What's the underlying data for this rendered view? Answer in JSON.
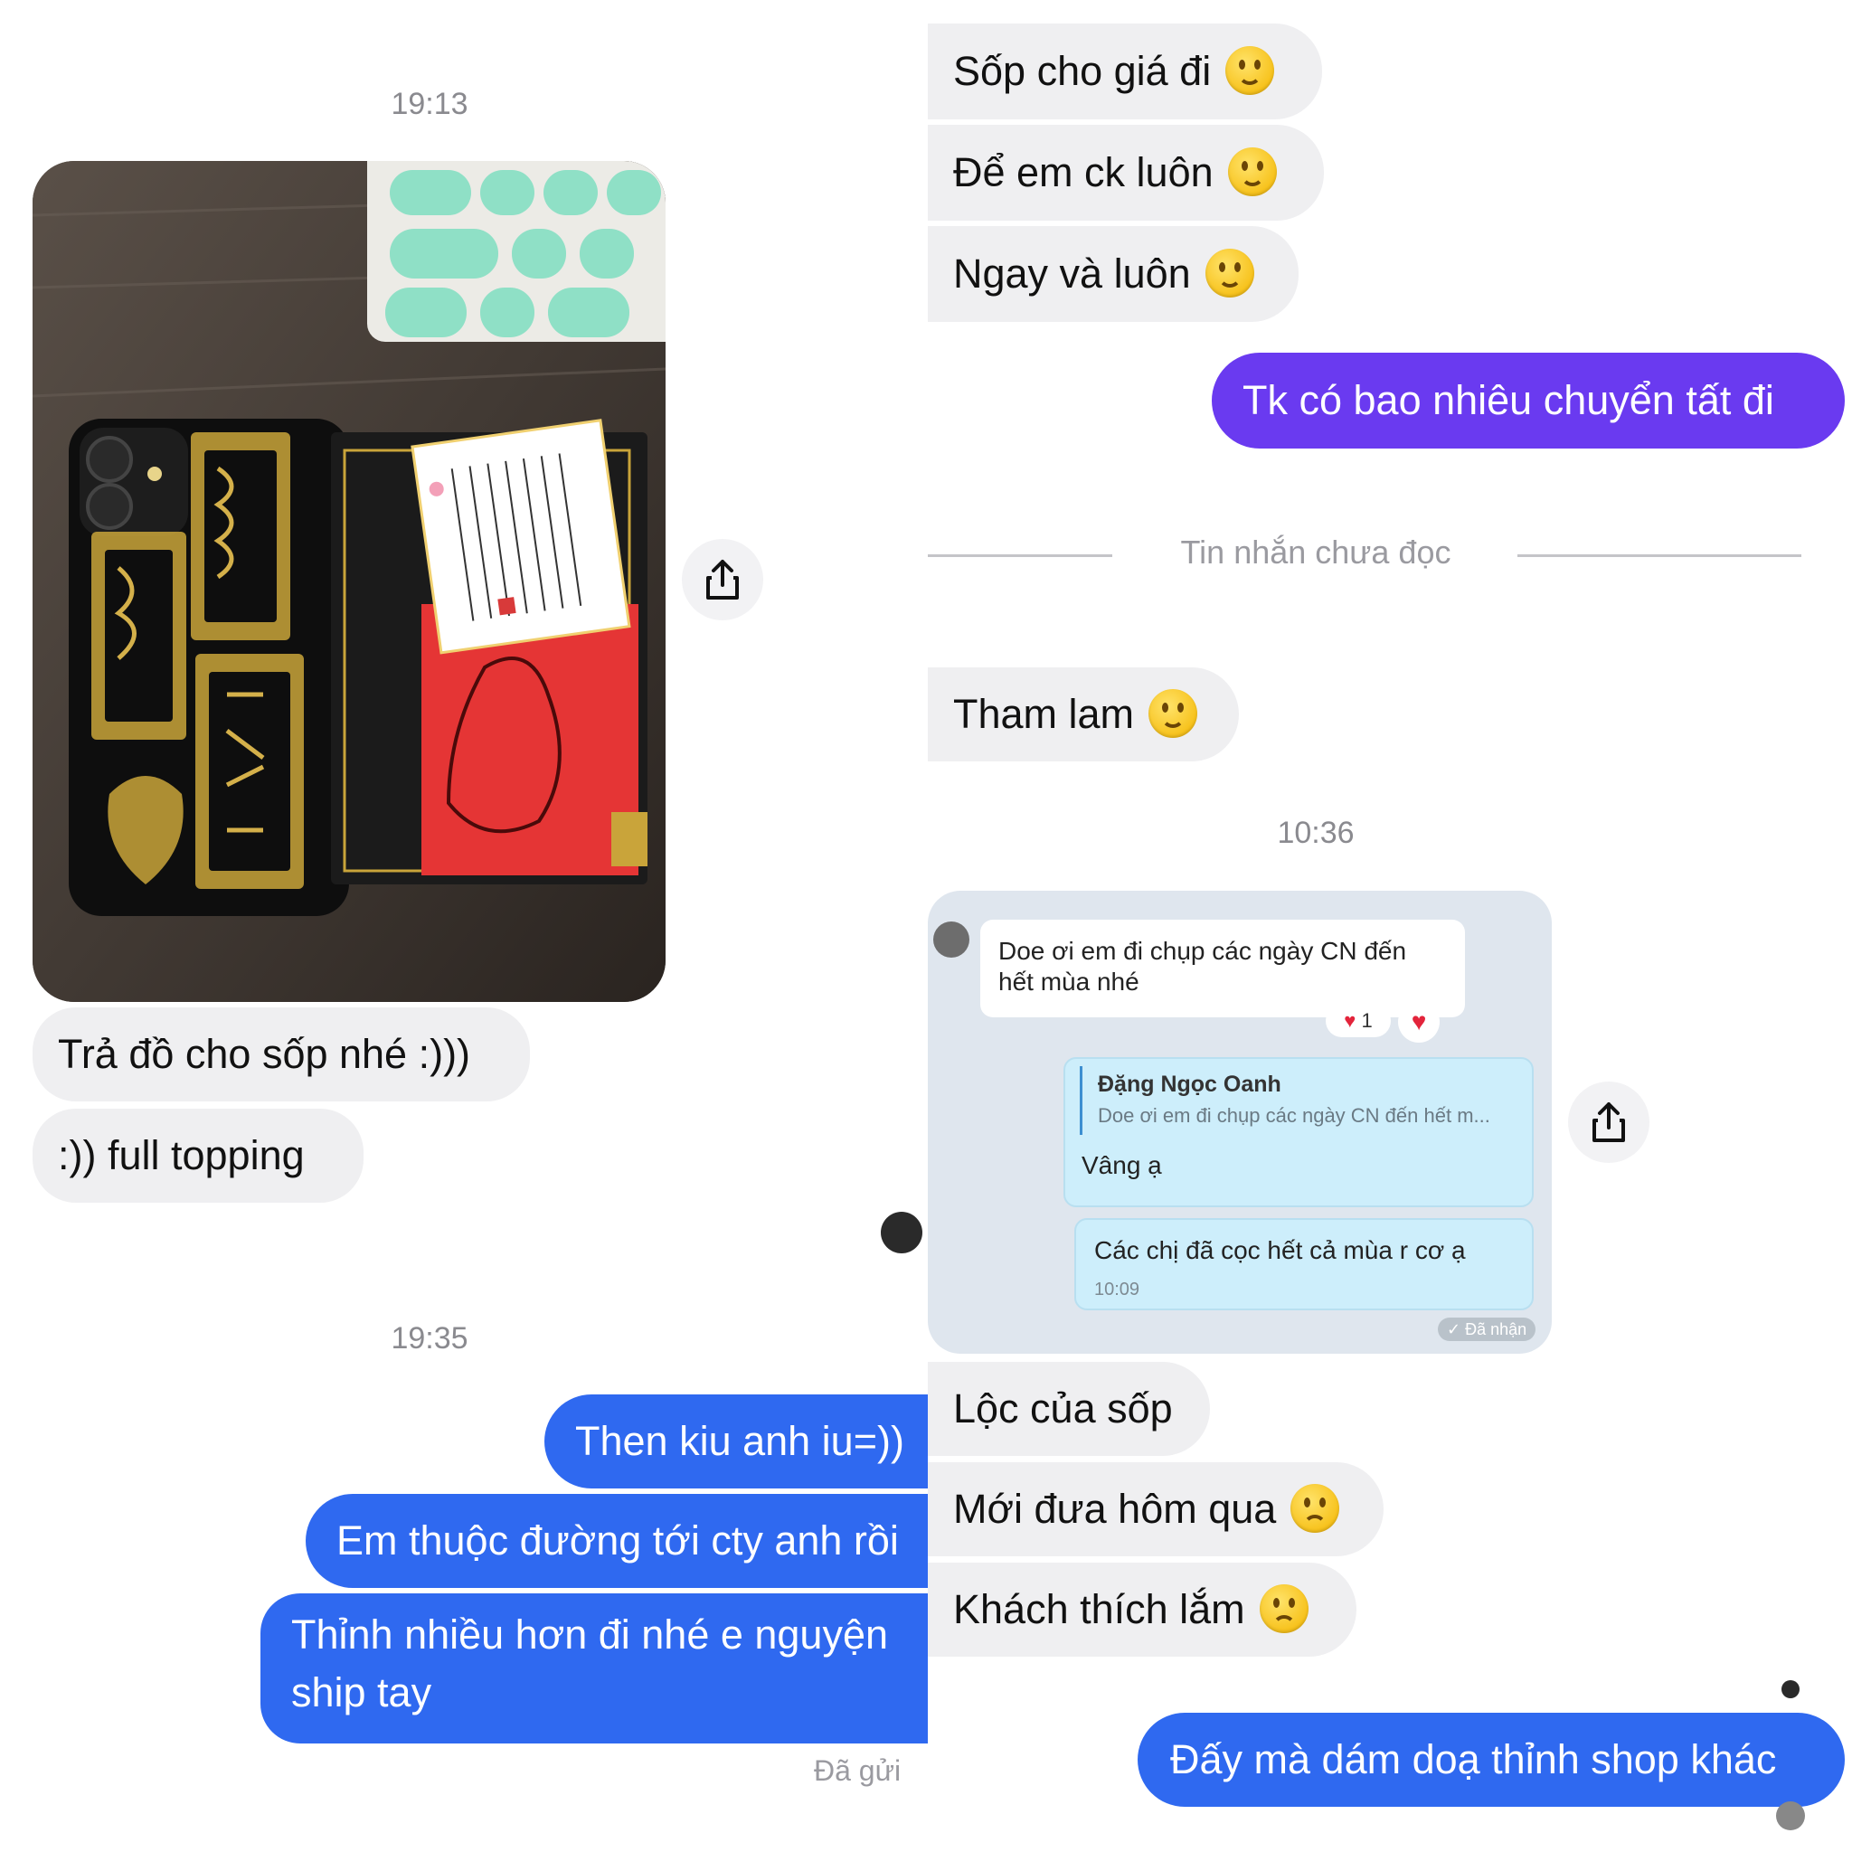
{
  "left": {
    "time_top": "19:13",
    "incoming": [
      "Trả đồ cho sốp nhé :)))",
      ":)) full topping"
    ],
    "time_mid": "19:35",
    "outgoing": [
      "Then kiu anh iu=))",
      "Em thuộc đường tới cty anh rồi",
      "Thỉnh nhiều hơn đi nhé e nguyện",
      "ship tay"
    ],
    "status": "Đã gửi"
  },
  "right": {
    "incoming_top": [
      "Sốp cho giá đi",
      "Để em ck luôn",
      "Ngay và luôn"
    ],
    "outgoing_purple": "Tk có bao nhiêu chuyển tất đi",
    "divider": "Tin nhắn chưa đọc",
    "incoming_mid": "Tham lam",
    "time": "10:36",
    "incoming_bottom": [
      "Lộc của sốp",
      "Mới đưa hôm qua",
      "Khách thích lắm"
    ],
    "outgoing_blue": "Đấy mà dám doạ thỉnh shop khác"
  },
  "embedded": {
    "msg1": "Doe ơi em đi chụp các ngày CN đến",
    "msg1b": "hết mùa nhé",
    "reaction_count": "1",
    "reply_name": "Đặng Ngọc Oanh",
    "reply_quote": "Doe ơi em đi chụp các ngày CN đến hết m...",
    "reply_text": "Vâng ạ",
    "msg2": "Các chị đã cọc hết cả mùa r cơ ạ",
    "msg2_time": "10:09",
    "status": "Đã nhận"
  },
  "colors": {
    "blue": "#2f69f0",
    "purple": "#6a3af0",
    "incoming": "#efeff1"
  }
}
